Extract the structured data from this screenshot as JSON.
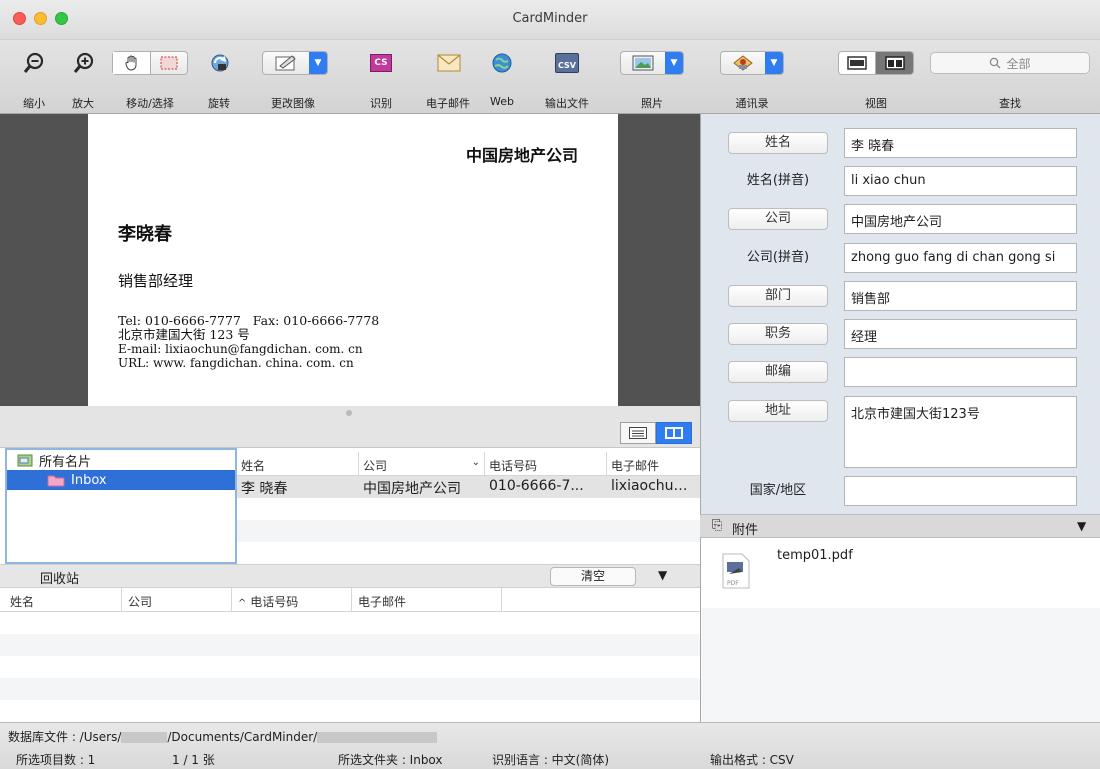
{
  "window": {
    "title": "CardMinder"
  },
  "toolbar": {
    "zoom_out": "缩小",
    "zoom_in": "放大",
    "move_select": "移动/选择",
    "rotate": "旋转",
    "change_image": "更改图像",
    "recognize": "识别",
    "recognize_icon_text": "CS",
    "email": "电子邮件",
    "web": "Web",
    "export": "输出文件",
    "export_icon_text": "CSV",
    "photo": "照片",
    "contacts": "通讯录",
    "view": "视图",
    "find": "查找",
    "search_placeholder": "全部"
  },
  "card": {
    "company": "中国房地产公司",
    "name": "李晓春",
    "title": "销售部经理",
    "line1": "Tel: 010-6666-7777   Fax: 010-6666-7778",
    "line2": "北京市建国大街 123 号",
    "line3": "E-mail: lixiaochun@fangdichan. com. cn",
    "line4": "URL: www. fangdichan. china. com. cn"
  },
  "folders": [
    {
      "label": "所有名片",
      "selected": false
    },
    {
      "label": "Inbox",
      "selected": true
    }
  ],
  "card_table": {
    "columns": [
      "姓名",
      "公司",
      "电话号码",
      "电子邮件"
    ],
    "rows": [
      [
        "李 晓春",
        "中国房地产公司",
        "010-6666-7...",
        "lixiaochun@"
      ]
    ]
  },
  "trash": {
    "label": "回收站",
    "clear_label": "清空",
    "columns": [
      "姓名",
      "公司",
      "电话号码",
      "电子邮件"
    ]
  },
  "fields": [
    {
      "label": "姓名",
      "value": "李 晓春",
      "button": true
    },
    {
      "label": "姓名(拼音)",
      "value": "li xiao chun",
      "button": false
    },
    {
      "label": "公司",
      "value": "中国房地产公司",
      "button": true
    },
    {
      "label": "公司(拼音)",
      "value": "zhong guo fang di chan gong si",
      "button": false
    },
    {
      "label": "部门",
      "value": "销售部",
      "button": true
    },
    {
      "label": "职务",
      "value": "经理",
      "button": true
    },
    {
      "label": "邮编",
      "value": "",
      "button": true
    },
    {
      "label": "地址",
      "value": "北京市建国大街123号",
      "button": true
    },
    {
      "label": "国家/地区",
      "value": "",
      "button": false
    }
  ],
  "attachments": {
    "label": "附件",
    "file_name": "temp01.pdf",
    "file_type": "PDF"
  },
  "status": {
    "db_prefix": "数据库文件 : /Users/",
    "db_middle": "/Documents/CardMinder/",
    "selected_count": "所选项目数 : 1",
    "page_count": "1 / 1 张",
    "selected_folder": "所选文件夹 : Inbox",
    "ocr_language": "识别语言 : 中文(简体)",
    "output_format": "输出格式 : CSV"
  }
}
